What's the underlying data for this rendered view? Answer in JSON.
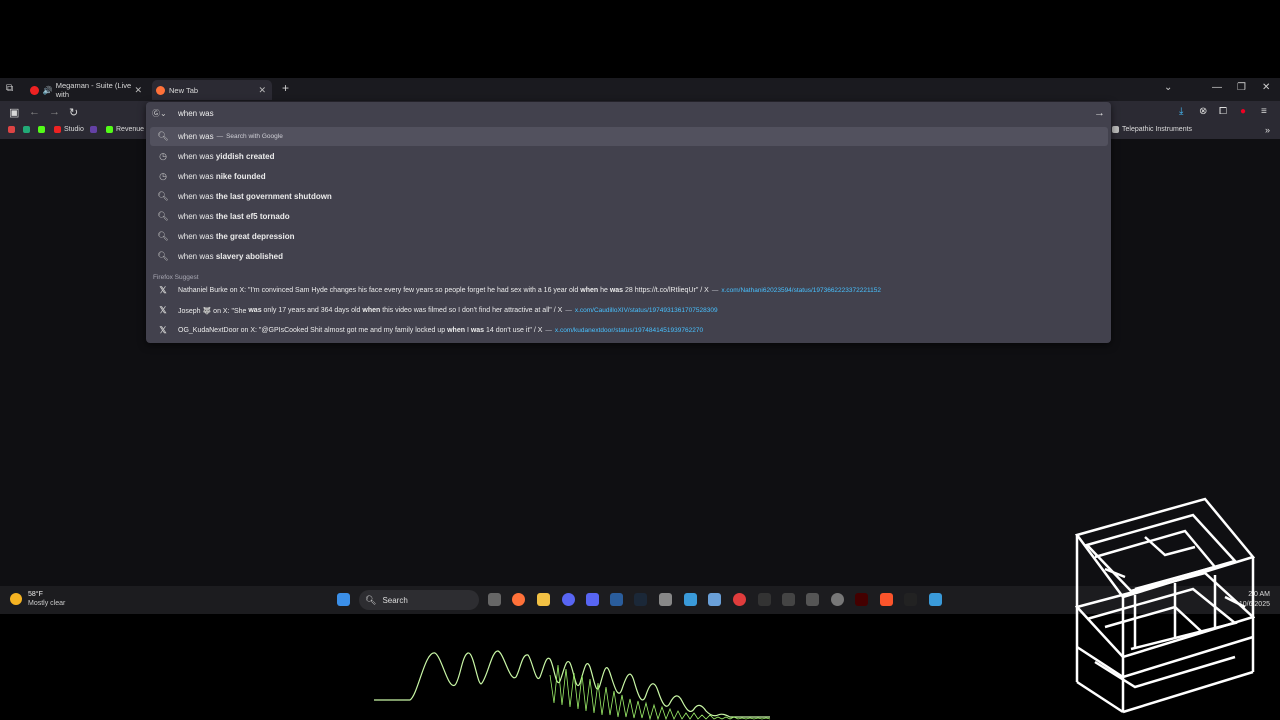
{
  "tabs": [
    {
      "label": "Megaman - Suite (Live with"
    },
    {
      "label": "New Tab"
    }
  ],
  "bookmarks": [
    {
      "label": "Studio"
    },
    {
      "label": "Revenue"
    },
    {
      "label": "Telepathic Instruments"
    }
  ],
  "urlbar": {
    "value": "when was"
  },
  "suggestions": {
    "search_row": {
      "query": "when was",
      "sep": "—",
      "hint": "Search with Google"
    },
    "history": [
      {
        "prefix": "when was",
        "bold": "yiddish created"
      },
      {
        "prefix": "when was",
        "bold": "nike founded"
      },
      {
        "prefix": "when was",
        "bold": "the last government shutdown"
      },
      {
        "prefix": "when was",
        "bold": "the last ef5 tornado"
      },
      {
        "prefix": "when was",
        "bold": "the great depression"
      },
      {
        "prefix": "when was",
        "bold": "slavery abolished"
      }
    ],
    "section_label": "Firefox Suggest",
    "suggest": [
      {
        "a": "Nathaniel Burke on X: \"I'm convinced Sam Hyde changes his face every few years so people forget he had sex with a 16 year old ",
        "b1": "when",
        "m": " he ",
        "b2": "was",
        "c": " 28 https://t.co/lRtlieqUr\" / X",
        "sep": "—",
        "url": "x.com/Nathani62023594/status/1973662223372221152"
      },
      {
        "a": "Joseph 🐺 on X: \"She ",
        "b1": "was",
        "m": " only 17 years and 364 days old ",
        "b2": "when",
        "c": " this video was filmed so I don't find her attractive at all\" / X",
        "sep": "—",
        "url": "x.com/CaudilloXIV/status/1974931361707528309"
      },
      {
        "a": "OG_KudaNextDoor on X: \"@GPIsCooked Shit almost got me and my family locked up ",
        "b1": "when",
        "m": " I ",
        "b2": "was",
        "c": " 14 don't use it\" / X",
        "sep": "—",
        "url": "x.com/kudanextdoor/status/1974841451939762270"
      }
    ]
  },
  "taskbar": {
    "weather_temp": "58°F",
    "weather_desc": "Mostly clear",
    "search_label": "Search",
    "time": "2:0 AM",
    "date": "10/6/2025"
  },
  "icons": [
    "tab-list-icon",
    "close-icon",
    "new-tab-icon",
    "back-icon",
    "forward-icon",
    "reload-icon",
    "search-icon",
    "history-icon",
    "x-logo-icon",
    "arrow-right-icon",
    "download-icon",
    "extensions-icon",
    "menu-icon"
  ]
}
